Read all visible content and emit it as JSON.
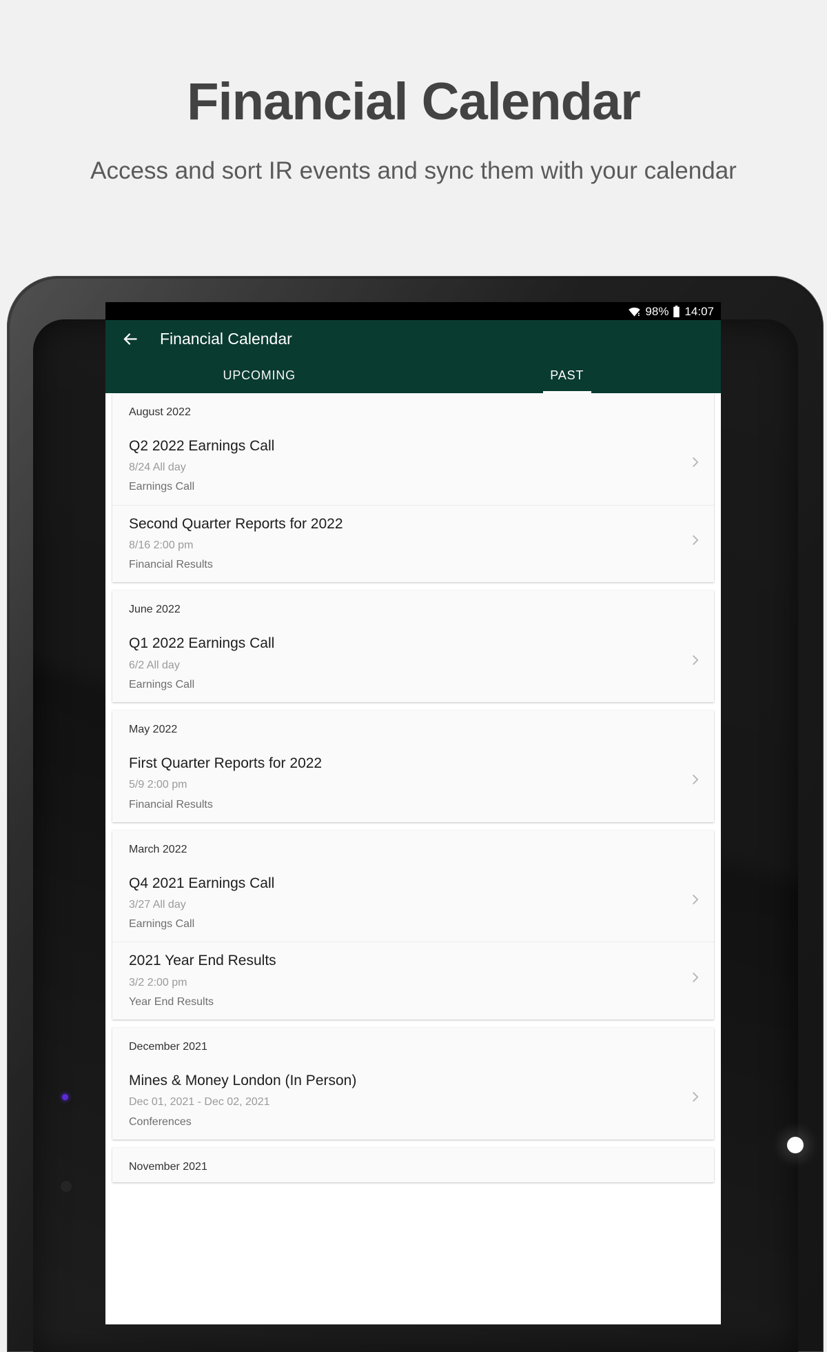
{
  "promo": {
    "title": "Financial Calendar",
    "subtitle": "Access and sort IR events and sync them with your calendar"
  },
  "theme": {
    "appbar_color": "#0a3b30",
    "page_background": "#f1f1f1",
    "card_background": "#fafafa"
  },
  "statusbar": {
    "wifi_icon": "wifi-icon",
    "battery_text": "98%",
    "battery_icon": "battery-icon",
    "time": "14:07"
  },
  "appbar": {
    "back_icon": "back-arrow-icon",
    "title": "Financial Calendar"
  },
  "tabs": [
    {
      "label": "UPCOMING",
      "active": false
    },
    {
      "label": "PAST",
      "active": true
    }
  ],
  "groups": [
    {
      "month": "August 2022",
      "events": [
        {
          "title": "Q2 2022 Earnings Call",
          "date": "8/24 All day",
          "type": "Earnings Call",
          "chevron": "chevron-right-icon"
        },
        {
          "title": "Second Quarter Reports for 2022",
          "date": "8/16 2:00 pm",
          "type": "Financial Results",
          "chevron": "chevron-right-icon"
        }
      ]
    },
    {
      "month": "June 2022",
      "events": [
        {
          "title": "Q1 2022 Earnings Call",
          "date": "6/2 All day",
          "type": "Earnings Call",
          "chevron": "chevron-right-icon"
        }
      ]
    },
    {
      "month": "May 2022",
      "events": [
        {
          "title": "First Quarter Reports for 2022",
          "date": "5/9 2:00 pm",
          "type": "Financial Results",
          "chevron": "chevron-right-icon"
        }
      ]
    },
    {
      "month": "March 2022",
      "events": [
        {
          "title": "Q4 2021 Earnings Call",
          "date": "3/27 All day",
          "type": "Earnings Call",
          "chevron": "chevron-right-icon"
        },
        {
          "title": "2021 Year End Results",
          "date": "3/2 2:00 pm",
          "type": "Year End Results",
          "chevron": "chevron-right-icon"
        }
      ]
    },
    {
      "month": "December 2021",
      "events": [
        {
          "title": "Mines & Money London (In Person)",
          "date": "Dec 01, 2021 - Dec 02, 2021",
          "type": "Conferences",
          "chevron": "chevron-right-icon"
        }
      ]
    },
    {
      "month": "November 2021",
      "events": []
    }
  ]
}
